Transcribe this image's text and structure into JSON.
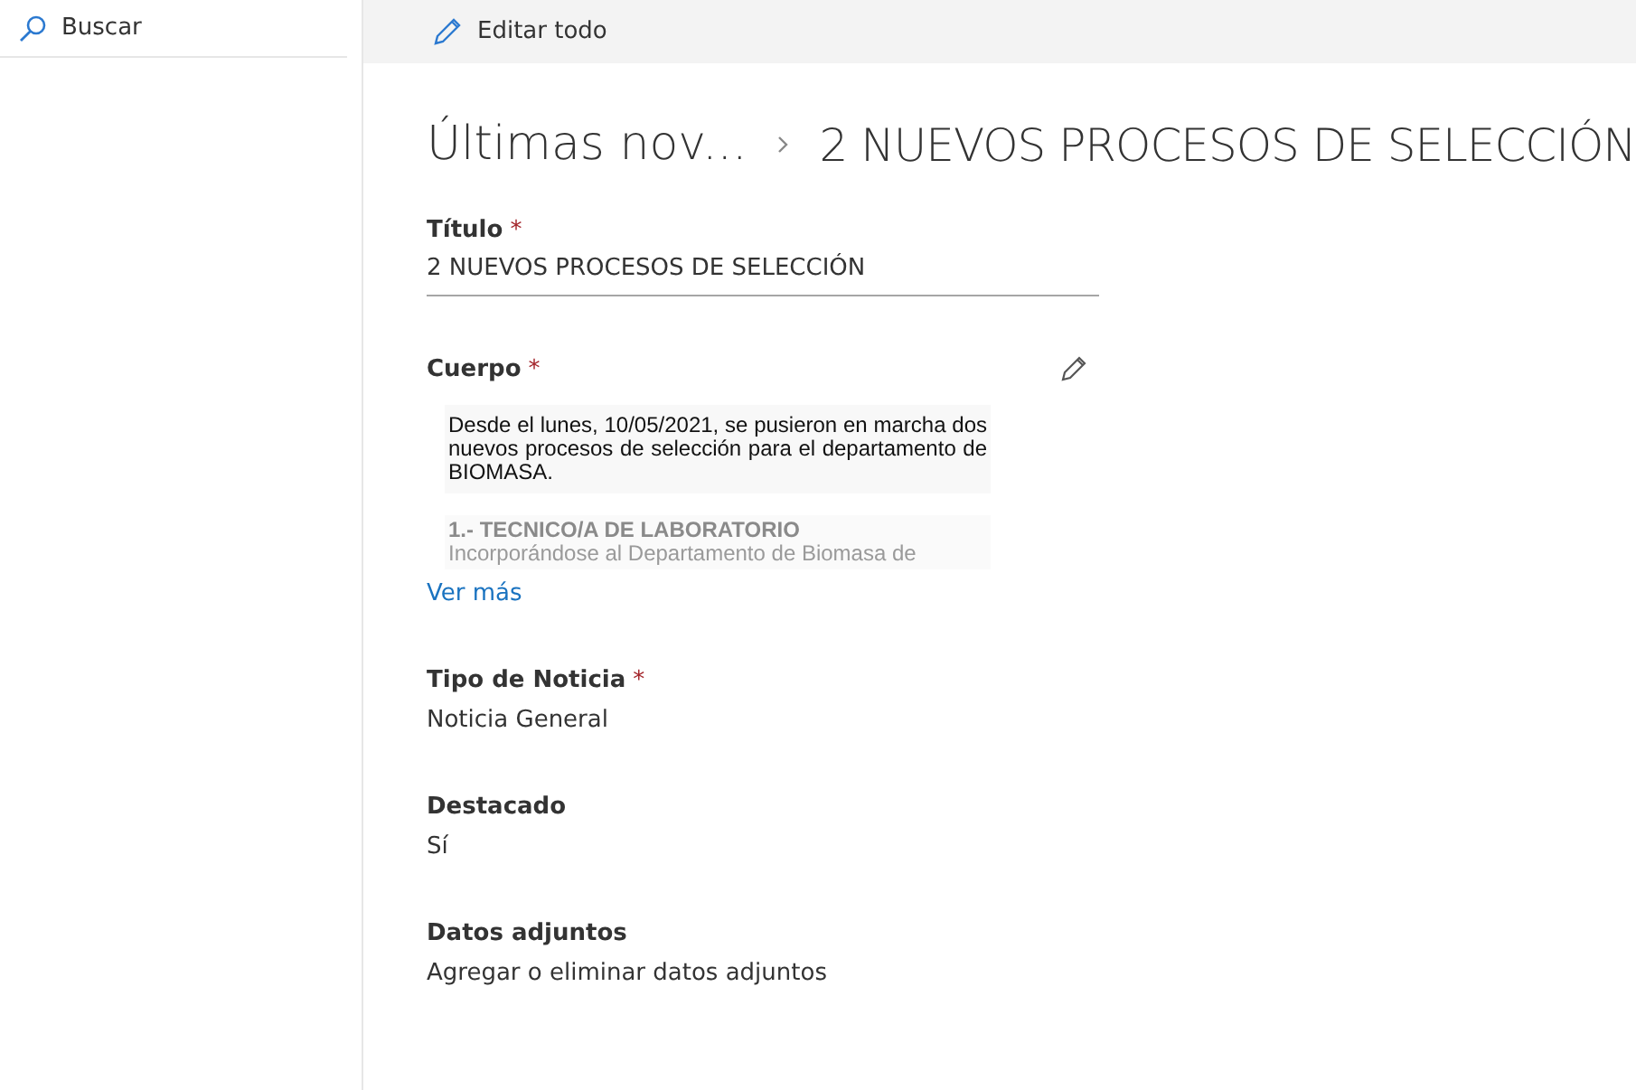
{
  "sidebar": {
    "search": {
      "placeholder": "Buscar"
    }
  },
  "toolbar": {
    "edit_all": "Editar todo"
  },
  "breadcrumb": {
    "parent": "Últimas nov...",
    "current": "2 NUEVOS PROCESOS DE SELECCIÓN"
  },
  "fields": [
    {
      "kind": "text",
      "label": "Título",
      "required_mark": "*",
      "value": "2 NUEVOS PROCESOS DE SELECCIÓN"
    },
    {
      "kind": "rich",
      "label": "Cuerpo",
      "required_mark": "*",
      "paragraphs": [
        "Desde el lunes, 10/05/2021, se pusieron en marcha dos nuevos procesos de selección para el departamento de BIOMASA."
      ],
      "faded_heading": "1.- TECNICO/A DE LABORATORIO",
      "faded_text": "Incorporándose al Departamento de Biomasa de",
      "more": "Ver más"
    },
    {
      "kind": "plain",
      "label": "Tipo de Noticia",
      "required_mark": "*",
      "value": "Noticia General"
    },
    {
      "kind": "plain",
      "label": "Destacado",
      "value": "Sí"
    },
    {
      "kind": "plain",
      "label": "Datos adjuntos",
      "value": "Agregar o eliminar datos adjuntos"
    }
  ]
}
